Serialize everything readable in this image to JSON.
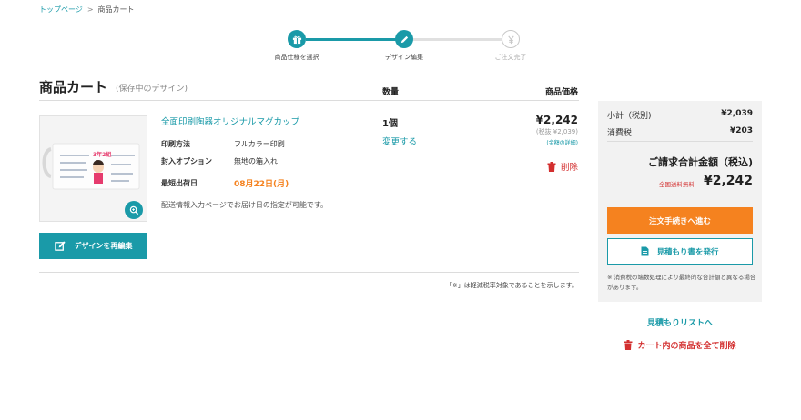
{
  "breadcrumb": {
    "home": "トップページ",
    "separator": ">",
    "current": "商品カート"
  },
  "stepper": {
    "steps": [
      {
        "label": "商品仕様を選択",
        "icon": "gift-icon",
        "state": "done"
      },
      {
        "label": "デザイン編集",
        "icon": "pencil-icon",
        "state": "current"
      },
      {
        "label": "ご注文完了",
        "icon": "yen-icon",
        "state": "todo"
      }
    ]
  },
  "cart": {
    "title": "商品カート",
    "subtitle": "(保存中のデザイン)",
    "col_quantity": "数量",
    "col_price": "商品価格"
  },
  "item": {
    "name": "全面印刷陶器オリジナルマグカップ",
    "specs": [
      {
        "label": "印刷方法",
        "value": "フルカラー印刷"
      },
      {
        "label": "封入オプション",
        "value": "無地の箱入れ"
      },
      {
        "label": "最短出荷日",
        "value": "08月22日(月)"
      }
    ],
    "delivery_note": "配送情報入力ページでお届け日の指定が可能です。",
    "edit_button": "デザインを再編集",
    "quantity": "1個",
    "change_link": "変更する",
    "price": "¥2,242",
    "price_excl": "(税抜 ¥2,039)",
    "price_detail": "(金額の詳細)",
    "delete": "削除",
    "mug_text": "3年2組"
  },
  "tax_note": "「※」は軽減税率対象であることを示します。",
  "summary": {
    "subtotal_label": "小計（税別)",
    "subtotal_value": "¥2,039",
    "tax_label": "消費税",
    "tax_value": "¥203",
    "total_heading": "ご請求合計金額（税込)",
    "shipping_free": "全国送料無料",
    "total_value": "¥2,242",
    "checkout_button": "注文手続きへ進む",
    "estimate_button": "見積もり書を発行",
    "note": "※ 消費税の端数処理により最終的な合計額と異なる場合があります。"
  },
  "links": {
    "estimate_list": "見積もりリストへ",
    "clear_cart": "カート内の商品を全て削除"
  },
  "colors": {
    "accent": "#1a9aa8",
    "orange": "#f5821f",
    "red": "#d32f2f",
    "inactive": "#c8c8c8"
  }
}
